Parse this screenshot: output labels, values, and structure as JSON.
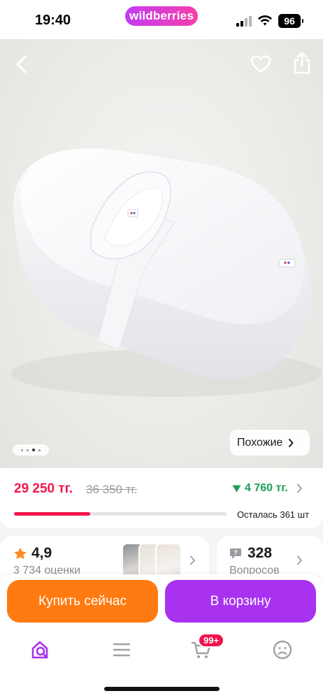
{
  "status_bar": {
    "time": "19:40",
    "brand": "wildberries",
    "battery": "96",
    "icons": [
      "signal-icon",
      "wifi-icon",
      "battery-icon"
    ]
  },
  "product": {
    "image_count": 4,
    "active_image": 3,
    "similar_label": "Похожие"
  },
  "header_icons": [
    "back-arrow-icon",
    "heart-icon",
    "share-icon"
  ],
  "price": {
    "current": "29 250 тг.",
    "old": "36 350 тг.",
    "discount": "4 760 тг.",
    "stock_label": "Осталась 361 шт",
    "stock_progress": 0.36
  },
  "rating": {
    "value": "4,9",
    "reviews": "3 734 оценки"
  },
  "questions": {
    "count": "328",
    "label": "Вопросов"
  },
  "actions": {
    "buy_now": "Купить сейчас",
    "add_to_cart": "В корзину"
  },
  "tabbar": {
    "items": [
      "home-search-icon",
      "catalog-icon",
      "cart-icon",
      "profile-icon"
    ],
    "cart_badge": "99+"
  },
  "colors": {
    "accent_pink": "#f0134d",
    "brand_purple": "#a832f0",
    "buy_orange": "#ff7a10",
    "discount_green": "#1d9f5a"
  }
}
